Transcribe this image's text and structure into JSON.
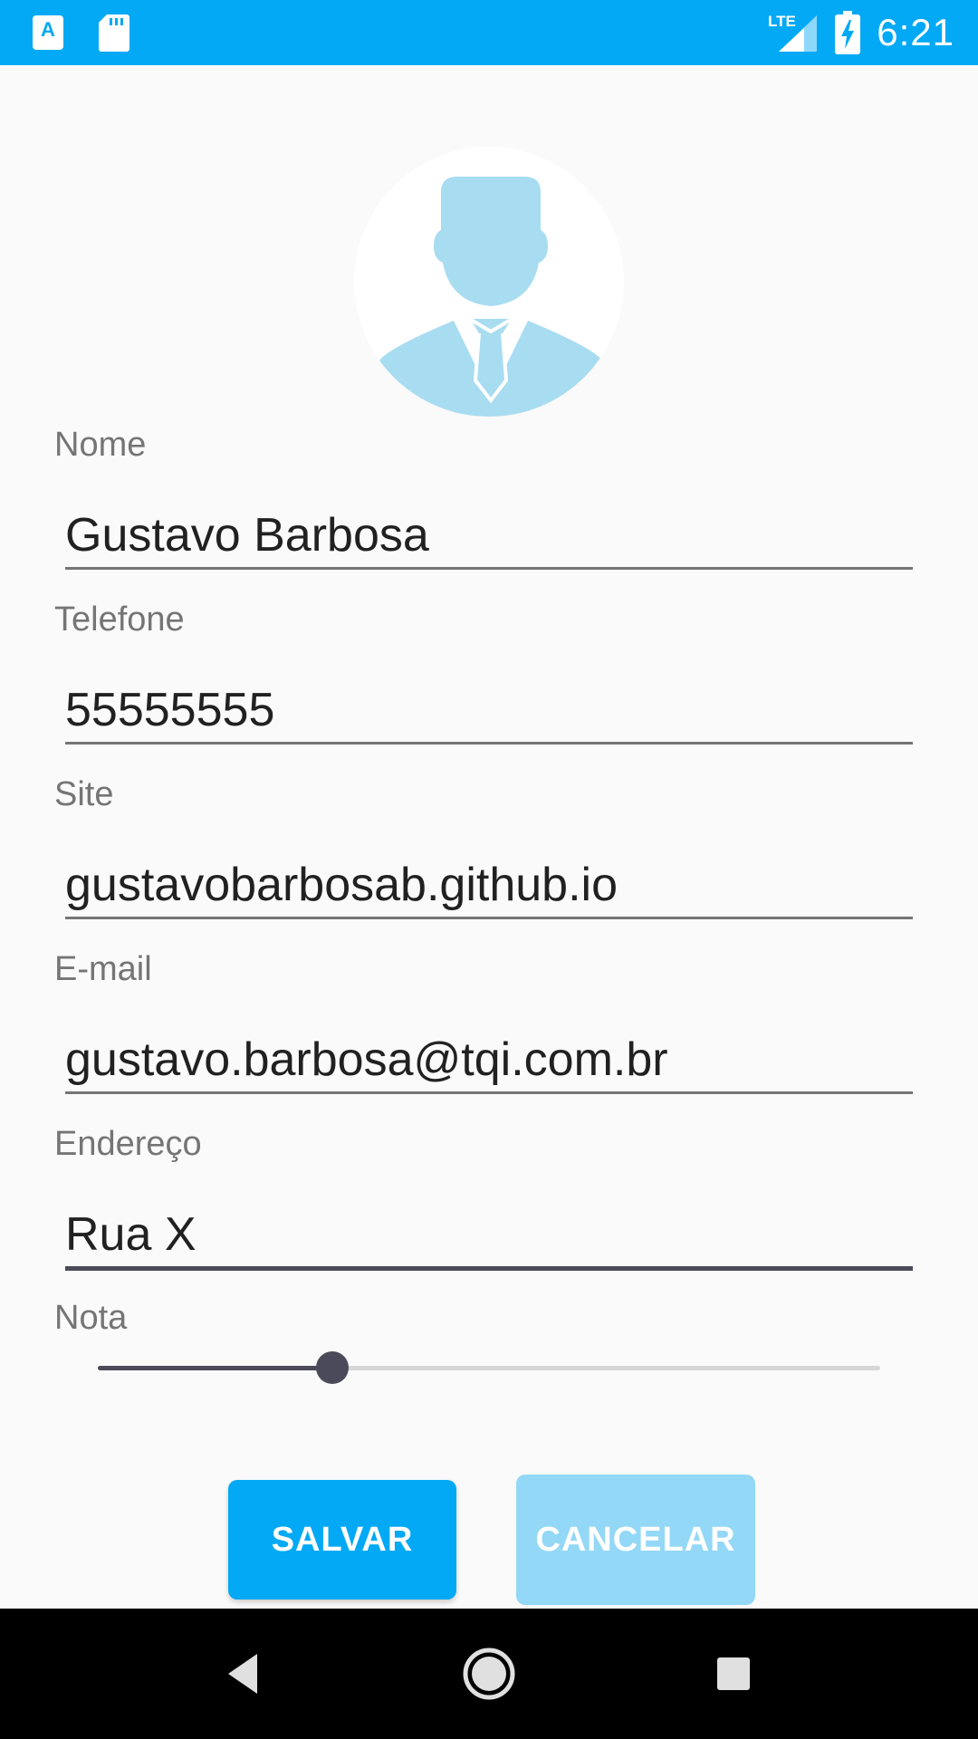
{
  "status_bar": {
    "app_icon_letter": "A",
    "network_label": "LTE",
    "time": "6:21",
    "icons": [
      "app-notification-icon",
      "sd-card-icon",
      "lte-signal-icon",
      "battery-charging-icon"
    ]
  },
  "avatar": {
    "icon": "person-avatar-icon"
  },
  "form": {
    "nome_label": "Nome",
    "nome_value": "Gustavo Barbosa",
    "telefone_label": "Telefone",
    "telefone_value": "55555555",
    "site_label": "Site",
    "site_value": "gustavobarbosab.github.io",
    "email_label": "E-mail",
    "email_value": "gustavo.barbosa@tqi.com.br",
    "endereco_label": "Endereço",
    "endereco_value": "Rua X",
    "nota_label": "Nota",
    "nota_fraction": 0.3
  },
  "buttons": {
    "save_label": "SALVAR",
    "cancel_label": "CANCELAR"
  },
  "navigation": {
    "icons": [
      "back-icon",
      "home-icon",
      "recents-icon"
    ]
  },
  "colors": {
    "primary": "#03a9f4",
    "primary_light": "#93d8f6",
    "avatar_tint": "#a8dcf1",
    "accent_dark": "#4a4a5a",
    "background": "#fafafa"
  }
}
